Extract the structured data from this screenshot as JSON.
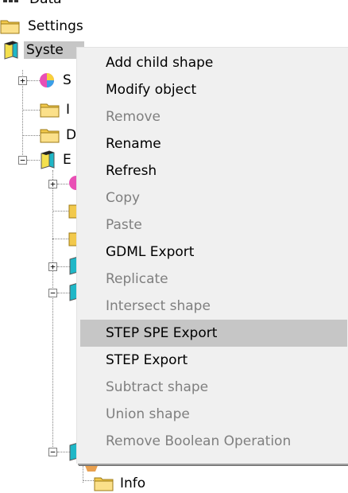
{
  "tree": {
    "items": [
      {
        "label": "Data"
      },
      {
        "label": "Settings"
      },
      {
        "label": "Syste"
      },
      {
        "label": "S"
      },
      {
        "label": "I"
      },
      {
        "label": "D"
      },
      {
        "label": "E"
      },
      {
        "label": "Info"
      }
    ]
  },
  "context_menu": {
    "items": [
      {
        "label": "Add child shape",
        "enabled": true
      },
      {
        "label": "Modify object",
        "enabled": true
      },
      {
        "label": "Remove",
        "enabled": false
      },
      {
        "label": "Rename",
        "enabled": true
      },
      {
        "label": "Refresh",
        "enabled": true
      },
      {
        "label": "Copy",
        "enabled": false
      },
      {
        "label": "Paste",
        "enabled": false
      },
      {
        "label": "GDML Export",
        "enabled": true
      },
      {
        "label": "Replicate",
        "enabled": false
      },
      {
        "label": "Intersect shape",
        "enabled": false
      },
      {
        "label": "STEP SPE Export",
        "enabled": true,
        "highlighted": true
      },
      {
        "label": "STEP Export",
        "enabled": true
      },
      {
        "label": "Subtract shape",
        "enabled": false
      },
      {
        "label": "Union shape",
        "enabled": false
      },
      {
        "label": "Remove Boolean Operation",
        "enabled": false
      }
    ]
  },
  "colors": {
    "folder": "#f2c94c",
    "highlight": "#c6c6c6",
    "disabled_text": "#7f7f7f",
    "menu_bg": "#f0f0f0"
  }
}
